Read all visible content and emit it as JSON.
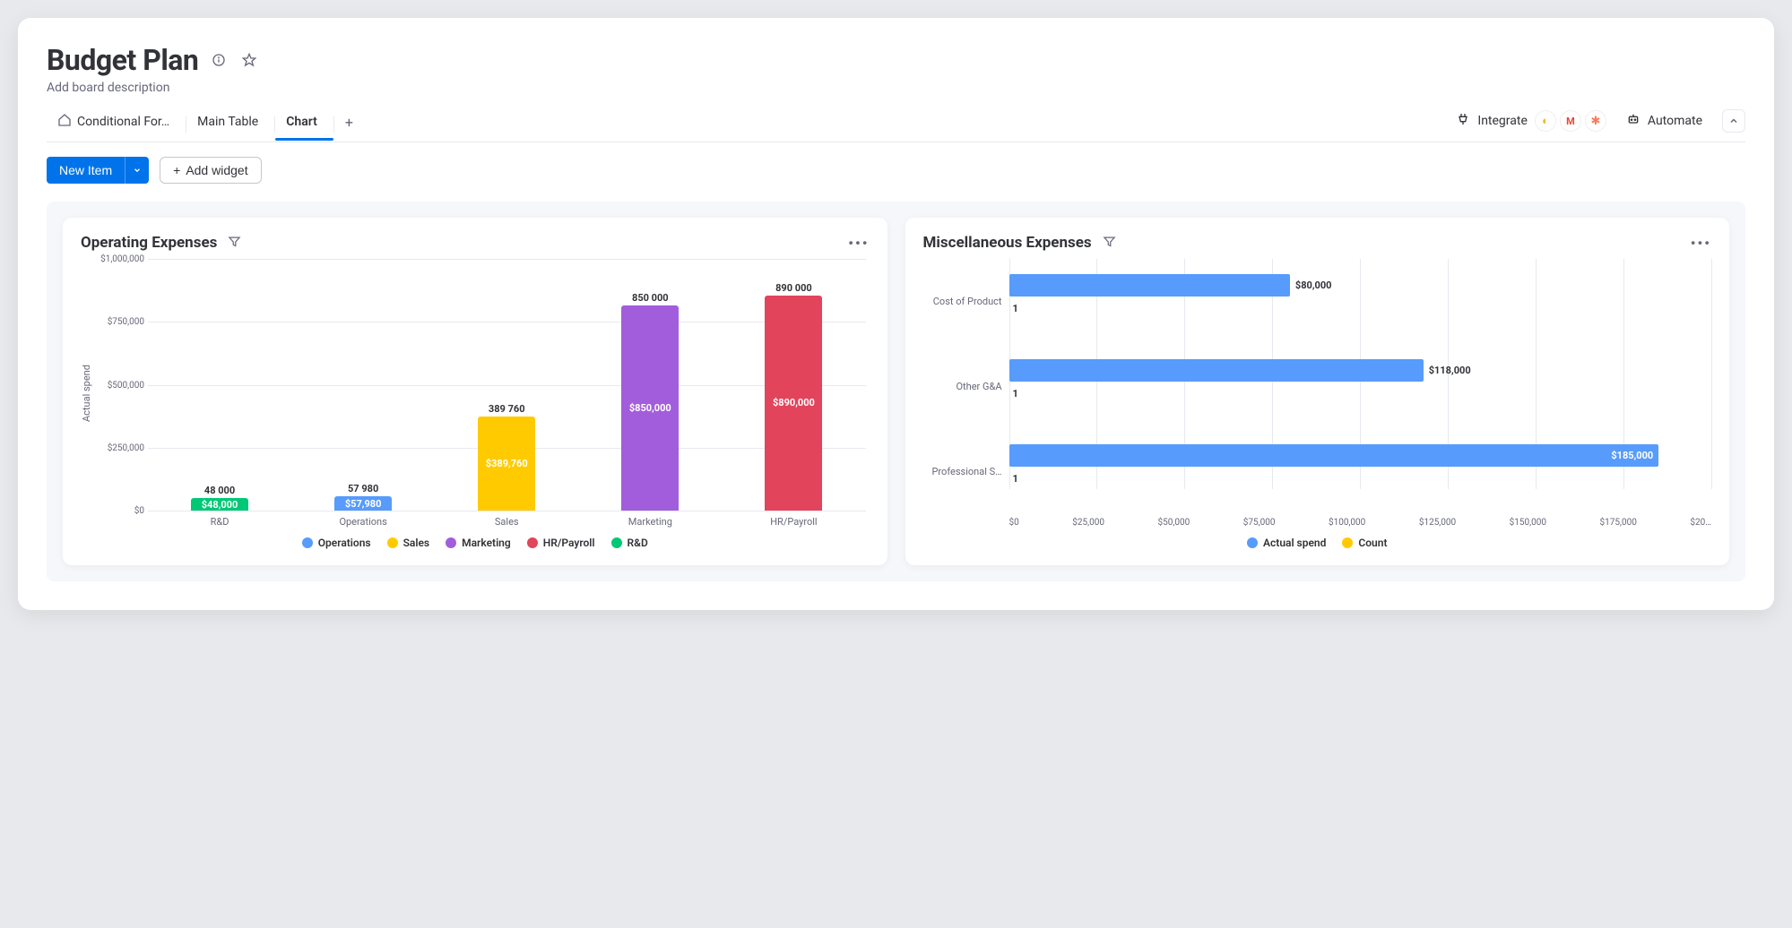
{
  "header": {
    "title": "Budget Plan",
    "description_placeholder": "Add board description"
  },
  "tabs": {
    "items": [
      {
        "label": "Conditional For…",
        "icon": "home"
      },
      {
        "label": "Main Table"
      },
      {
        "label": "Chart",
        "active": true
      }
    ],
    "integrate_label": "Integrate",
    "automate_label": "Automate"
  },
  "actions": {
    "new_item_label": "New Item",
    "add_widget_label": "Add widget"
  },
  "widgets": {
    "operating": {
      "title": "Operating Expenses"
    },
    "misc": {
      "title": "Miscellaneous Expenses"
    }
  },
  "chart_data": [
    {
      "id": "operating-expenses",
      "type": "bar",
      "orientation": "vertical",
      "title": "Operating Expenses",
      "ylabel": "Actual spend",
      "ylim": [
        0,
        1000000
      ],
      "yticks": [
        "$0",
        "$250,000",
        "$500,000",
        "$750,000",
        "$1,000,000"
      ],
      "categories": [
        "R&D",
        "Operations",
        "Sales",
        "Marketing",
        "HR/Payroll"
      ],
      "values": [
        48000,
        57980,
        389760,
        850000,
        890000
      ],
      "top_labels": [
        "48 000",
        "57 980",
        "389 760",
        "850 000",
        "890 000"
      ],
      "in_labels": [
        "$48,000",
        "$57,980",
        "$389,760",
        "$850,000",
        "$890,000"
      ],
      "bar_colors": [
        "#00c875",
        "#579bfc",
        "#ffcb00",
        "#a25ddc",
        "#e2445c"
      ],
      "legend": [
        {
          "name": "Operations",
          "color": "#579bfc"
        },
        {
          "name": "Sales",
          "color": "#ffcb00"
        },
        {
          "name": "Marketing",
          "color": "#a25ddc"
        },
        {
          "name": "HR/Payroll",
          "color": "#e2445c"
        },
        {
          "name": "R&D",
          "color": "#00c875"
        }
      ]
    },
    {
      "id": "miscellaneous-expenses",
      "type": "bar",
      "orientation": "horizontal",
      "title": "Miscellaneous Expenses",
      "categories": [
        "Cost of Product",
        "Other G&A",
        "Professional S…"
      ],
      "series": [
        {
          "name": "Actual spend",
          "color": "#579bfc",
          "values": [
            80000,
            118000,
            185000
          ],
          "labels": [
            "$80,000",
            "$118,000",
            "$185,000"
          ]
        },
        {
          "name": "Count",
          "color": "#ffcb00",
          "values": [
            1,
            1,
            1
          ],
          "labels": [
            "1",
            "1",
            "1"
          ]
        }
      ],
      "xlim": [
        0,
        200000
      ],
      "xticks": [
        "$0",
        "$25,000",
        "$50,000",
        "$75,000",
        "$100,000",
        "$125,000",
        "$150,000",
        "$175,000",
        "$20…"
      ],
      "legend": [
        {
          "name": "Actual spend",
          "color": "#579bfc"
        },
        {
          "name": "Count",
          "color": "#ffcb00"
        }
      ]
    }
  ]
}
